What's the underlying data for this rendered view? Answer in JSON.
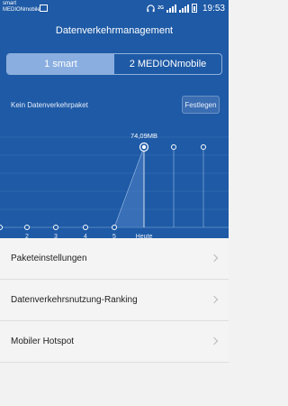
{
  "statusbar": {
    "carrier_line1": "smart",
    "carrier_line2": "MEDIONmobile",
    "network_label": "2G",
    "time": "19:53"
  },
  "header": {
    "title": "Datenverkehrmanagement"
  },
  "tabs": [
    {
      "label": "1 smart",
      "active": true
    },
    {
      "label": "2 MEDIONmobile",
      "active": false
    }
  ],
  "package": {
    "label": "Kein Datenverkehrpaket",
    "button_label": "Festlegen"
  },
  "chart_data": {
    "type": "line",
    "categories": [
      "",
      "2",
      "3",
      "4",
      "5",
      "Heute",
      "",
      ""
    ],
    "values": [
      0,
      0,
      0,
      0,
      0,
      74.09,
      null,
      null
    ],
    "highlight_label": "74,09MB",
    "unit": "MB"
  },
  "menu": {
    "items": [
      {
        "label": "Paketeinstellungen"
      },
      {
        "label": "Datenverkehrsnutzung-Ranking"
      },
      {
        "label": "Mobiler Hotspot"
      }
    ]
  },
  "colors": {
    "header_bg": "#1e5aa6",
    "tab_active": "#8aaee0",
    "menu_bg": "#f4f4f4"
  }
}
